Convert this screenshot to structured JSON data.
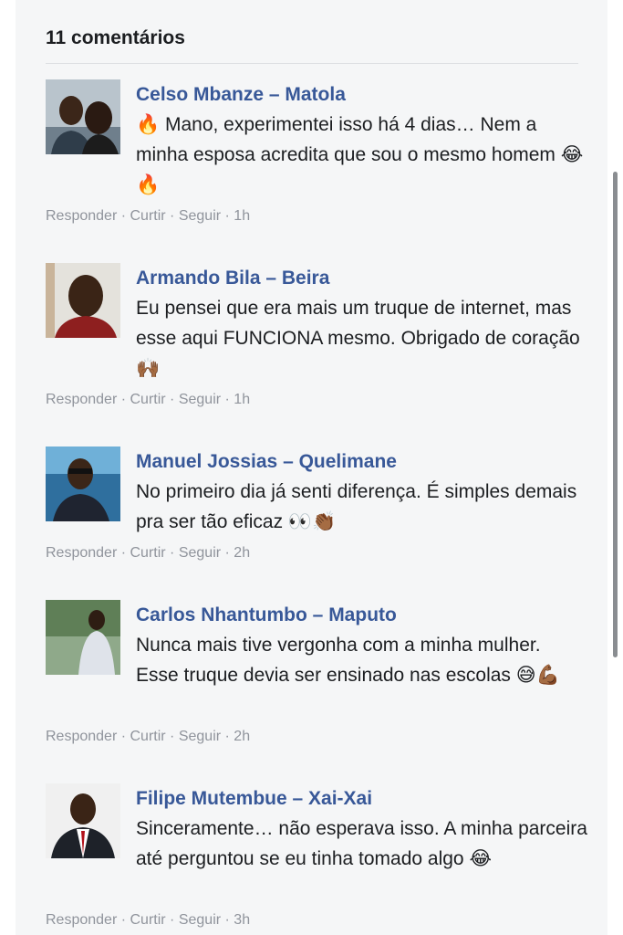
{
  "header": {
    "title": "11 comentários"
  },
  "actions": {
    "reply": "Responder",
    "like": "Curtir",
    "follow": "Seguir",
    "sep": " · "
  },
  "comments": [
    {
      "author": "Celso Mbanze – Matola",
      "text": "🔥 Mano, experimentei isso há 4 dias… Nem a minha esposa acredita que sou o mesmo homem 😂🔥",
      "time": "1h"
    },
    {
      "author": "Armando Bila – Beira",
      "text": "Eu pensei que era mais um truque de internet, mas esse aqui FUNCIONA mesmo. Obrigado de coração 🙌🏾",
      "time": "1h"
    },
    {
      "author": "Manuel Jossias – Quelimane",
      "text": "No primeiro dia já senti diferença. É simples demais pra ser tão eficaz 👀👏🏾",
      "time": "2h"
    },
    {
      "author": "Carlos Nhantumbo – Maputo",
      "text": "Nunca mais tive vergonha com a minha mulher. Esse truque devia ser ensinado nas escolas 😅💪🏾",
      "time": "2h"
    },
    {
      "author": "Filipe Mutembue – Xai-Xai",
      "text": "Sinceramente… não esperava isso. A minha parceira até perguntou se eu tinha tomado algo 😂",
      "time": "3h"
    }
  ]
}
